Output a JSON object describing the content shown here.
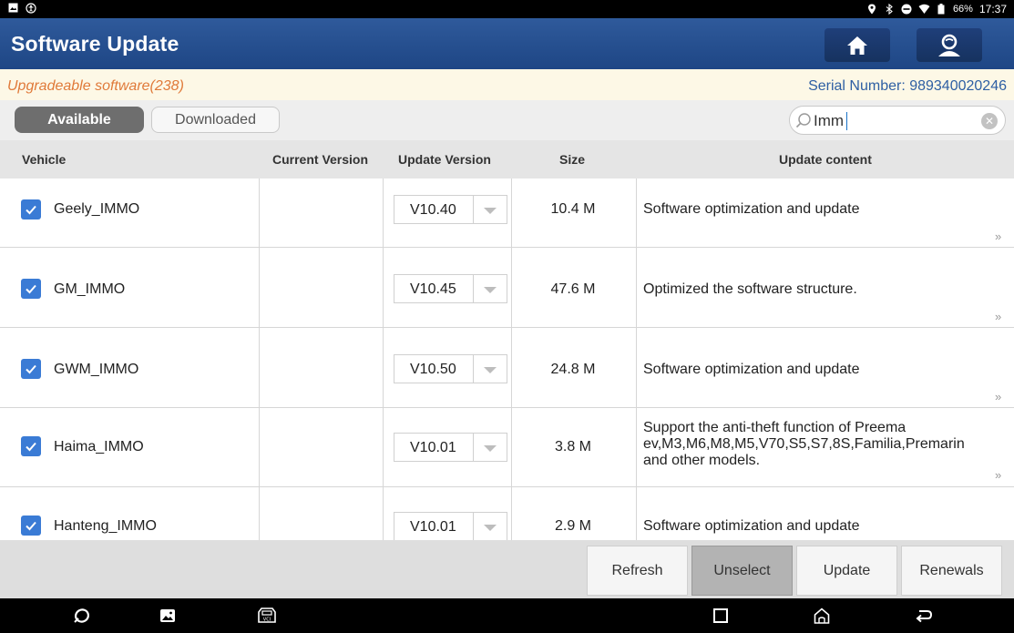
{
  "status_bar": {
    "left_icons": [
      "image-icon",
      "accessibility-icon"
    ],
    "right_icons": [
      "location-icon",
      "bluetooth-icon",
      "do-not-disturb-icon",
      "wifi-icon",
      "battery-icon"
    ],
    "battery": "66%",
    "time": "17:37"
  },
  "header": {
    "title": "Software Update",
    "home_icon": "home-icon",
    "user_icon": "user-support-icon"
  },
  "info": {
    "upgradeable": "Upgradeable software(238)",
    "serial": "Serial Number: 989340020246"
  },
  "tabs": [
    {
      "label": "Available",
      "active": true
    },
    {
      "label": "Downloaded",
      "active": false
    }
  ],
  "search": {
    "value": "Imm",
    "clear_icon": "clear-icon"
  },
  "table": {
    "columns": [
      "Vehicle",
      "Current Version",
      "Update Version",
      "Size",
      "Update content"
    ],
    "rows": [
      {
        "vehicle": "Geely_IMMO",
        "current": "",
        "update": "V10.40",
        "size": "10.4 M",
        "content": "Software optimization and update",
        "checked": true
      },
      {
        "vehicle": "GM_IMMO",
        "current": "",
        "update": "V10.45",
        "size": "47.6 M",
        "content": "Optimized the software structure.",
        "checked": true
      },
      {
        "vehicle": "GWM_IMMO",
        "current": "",
        "update": "V10.50",
        "size": "24.8 M",
        "content": "Software optimization and update",
        "checked": true
      },
      {
        "vehicle": "Haima_IMMO",
        "current": "",
        "update": "V10.01",
        "size": "3.8 M",
        "content": "Support the anti-theft function of Preema ev,M3,M6,M8,M5,V70,S5,S7,8S,Familia,Premarin and other models.",
        "checked": true
      },
      {
        "vehicle": "Hanteng_IMMO",
        "current": "",
        "update": "V10.01",
        "size": "2.9 M",
        "content": "Software optimization and update",
        "checked": true
      }
    ],
    "more_glyph": "»"
  },
  "actions": {
    "refresh": "Refresh",
    "unselect": "Unselect",
    "update": "Update",
    "renewals": "Renewals"
  },
  "nav_bar": {
    "icons": [
      "browser-icon",
      "gallery-icon",
      "vci-icon",
      "recents-icon",
      "home-icon",
      "back-icon"
    ]
  },
  "colors": {
    "header": "#2a5194",
    "accent_orange": "#e07a3a",
    "serial_blue": "#2e5fa3",
    "checkbox": "#3a7bd5"
  }
}
